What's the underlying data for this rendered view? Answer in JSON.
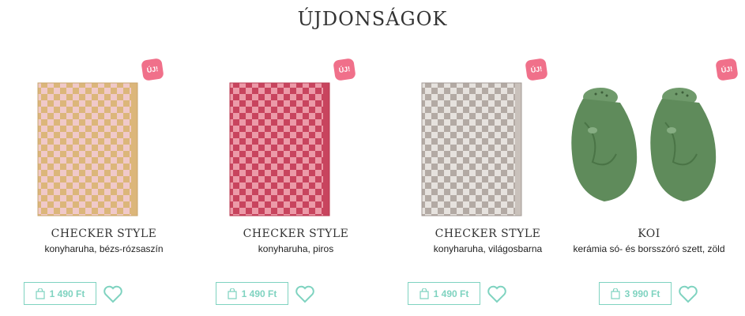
{
  "section": {
    "title": "ÚJDONSÁGOK"
  },
  "colors": {
    "accent": "#7fd3c0",
    "badge": "#f0708a"
  },
  "products": [
    {
      "badge": "ÚJ!",
      "name": "CHECKER STYLE",
      "description": "konyharuha, bézs-rózsaszín",
      "price": "1 490 Ft",
      "image": "beige-pink checkered kitchen towel"
    },
    {
      "badge": "ÚJ!",
      "name": "CHECKER STYLE",
      "description": "konyharuha, piros",
      "price": "1 490 Ft",
      "image": "red checkered kitchen towel"
    },
    {
      "badge": "ÚJ!",
      "name": "CHECKER STYLE",
      "description": "konyharuha, világosbarna",
      "price": "1 490 Ft",
      "image": "light brown checkered kitchen towel"
    },
    {
      "badge": "ÚJ!",
      "name": "KOI",
      "description": "kerámia só- és borsszóró szett, zöld",
      "price": "3 990 Ft",
      "image": "green ceramic koi fish salt and pepper shakers"
    }
  ]
}
